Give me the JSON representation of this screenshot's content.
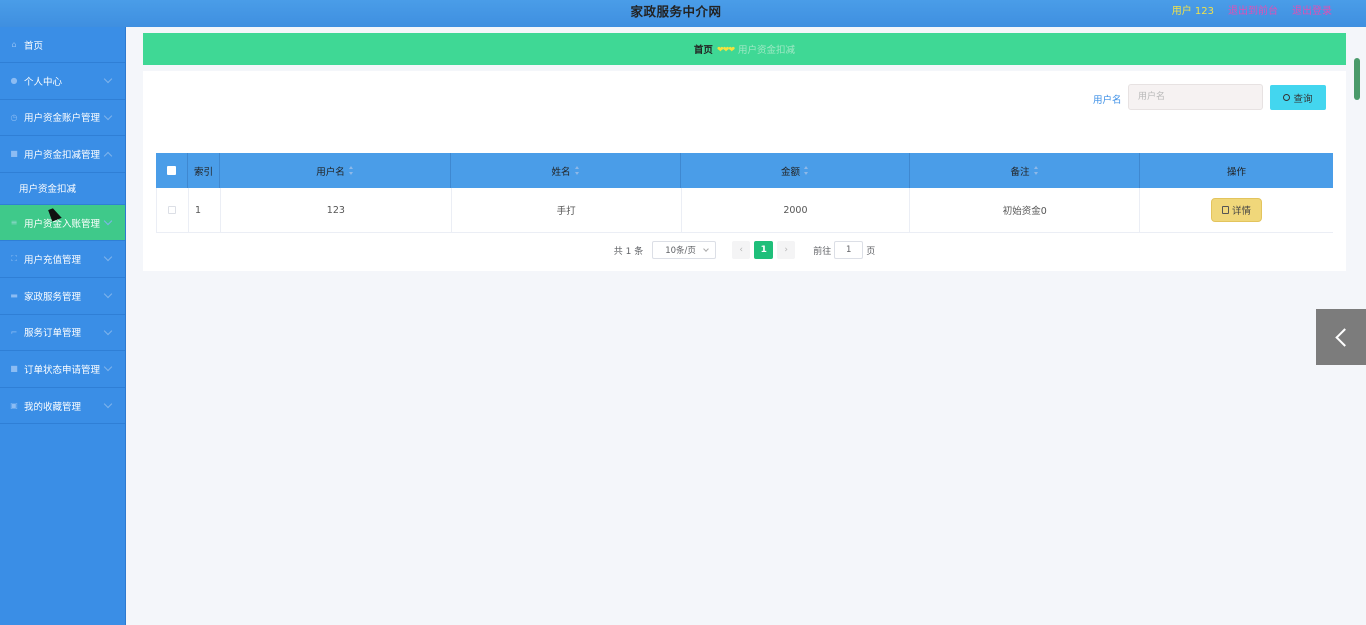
{
  "header": {
    "title": "家政服务中介网",
    "user_label": "用户 123",
    "back_label": "退出到前台",
    "logout_label": "退出登录"
  },
  "sidebar": {
    "items": [
      {
        "label": "首页",
        "icon": "home-icon"
      },
      {
        "label": "个人中心",
        "icon": "user-icon"
      },
      {
        "label": "用户资金账户管理",
        "icon": "clock-icon"
      },
      {
        "label": "用户资金扣减管理",
        "icon": "chat-icon"
      },
      {
        "label": "用户资金扣减",
        "icon": ""
      },
      {
        "label": "用户资金入账管理",
        "icon": "list-icon"
      },
      {
        "label": "用户充值管理",
        "icon": "expand-icon"
      },
      {
        "label": "家政服务管理",
        "icon": "folder-icon"
      },
      {
        "label": "服务订单管理",
        "icon": "crop-icon"
      },
      {
        "label": "订单状态申请管理",
        "icon": "bag-icon"
      },
      {
        "label": "我的收藏管理",
        "icon": "box-icon"
      }
    ]
  },
  "breadcrumb": {
    "home": "首页",
    "separator": "❤❤❤",
    "current": "用户资金扣减"
  },
  "search": {
    "label": "用户名",
    "placeholder": "用户名",
    "button_label": "查询"
  },
  "table": {
    "headers": [
      "索引",
      "用户名",
      "姓名",
      "金额",
      "备注",
      "操作"
    ],
    "rows": [
      {
        "index": "1",
        "username": "123",
        "name": "手打",
        "amount": "2000",
        "note": "初始资金0",
        "action": "详情"
      }
    ]
  },
  "pagination": {
    "total": "共 1 条",
    "page_size": "10条/页",
    "prev": "‹",
    "current_page": "1",
    "next": "›",
    "goto_label": "前往",
    "goto_value": "1",
    "page_suffix": "页"
  },
  "colors": {
    "header_bg": "#4a9de8",
    "sidebar_bg": "#3a8ee6",
    "breadcrumb_bg": "#3fd895",
    "active_menu": "#3fc98a",
    "search_button": "#43d6ef",
    "detail_button": "#f0d77a"
  }
}
